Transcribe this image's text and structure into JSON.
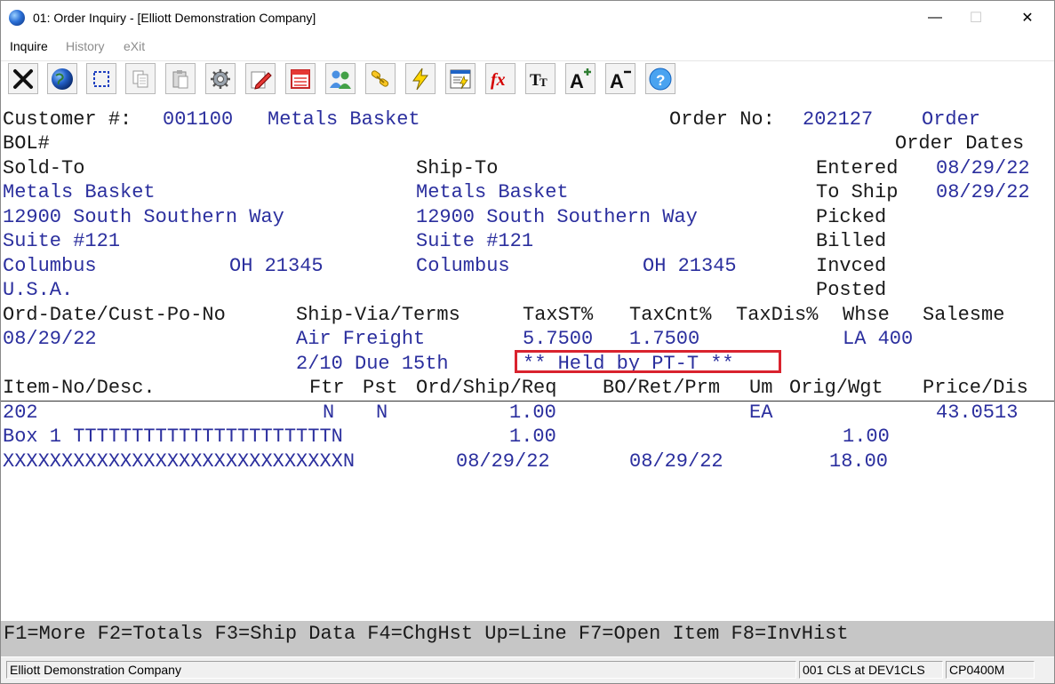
{
  "window": {
    "title": "01: Order Inquiry - [Elliott Demonstration Company]",
    "minimize_glyph": "—",
    "maximize_glyph": "☐",
    "close_glyph": "✕"
  },
  "menu": {
    "inquire": "Inquire",
    "history": "History",
    "exit": "eXit"
  },
  "toolbar_icons": [
    "exit-x-icon",
    "globe-icon",
    "select-rect-icon",
    "copy-icon",
    "paste-icon",
    "settings-gear-icon",
    "edit-pencil-icon",
    "calendar-icon",
    "users-icon",
    "link-icon",
    "lightning-icon",
    "report-icon",
    "function-fx-icon",
    "font-size-icon",
    "increase-font-icon",
    "decrease-font-icon",
    "help-icon"
  ],
  "header": {
    "customer_label": "Customer #:",
    "customer_no": "001100",
    "customer_name": "Metals Basket",
    "order_no_label": "Order No:",
    "order_no": "202127",
    "order_type": "Order",
    "bol_label": "BOL#",
    "order_dates_label": "Order Dates"
  },
  "sold_to": {
    "label": "Sold-To",
    "name": "Metals Basket",
    "addr1": "12900 South Southern Way",
    "addr2": "Suite #121",
    "city": "Columbus",
    "state_zip": "OH 21345",
    "country": "U.S.A."
  },
  "ship_to": {
    "label": "Ship-To",
    "name": "Metals Basket",
    "addr1": "12900 South Southern Way",
    "addr2": "Suite #121",
    "city": "Columbus",
    "state_zip": "OH 21345"
  },
  "dates": {
    "entered_label": "Entered",
    "entered": "08/29/22",
    "to_ship_label": "To Ship",
    "to_ship": "08/29/22",
    "picked_label": "Picked",
    "billed_label": "Billed",
    "invced_label": "Invced",
    "posted_label": "Posted"
  },
  "order_info": {
    "col_date_po": "Ord-Date/Cust-Po-No",
    "col_ship_via": "Ship-Via/Terms",
    "col_taxst": "TaxST%",
    "col_taxcnt": "TaxCnt%",
    "col_taxdis": "TaxDis%",
    "col_whse": "Whse",
    "col_salesman": "Salesme",
    "ord_date": "08/29/22",
    "ship_via": "Air Freight",
    "taxst": "5.7500",
    "taxcnt": "1.7500",
    "whse_sales": "LA 400",
    "terms": "2/10 Due 15th",
    "held": "** Held by PT-T **"
  },
  "lines_header": {
    "item": "Item-No/Desc.",
    "ftr": "Ftr",
    "pst": "Pst",
    "ord_ship_req": "Ord/Ship/Req",
    "bo_ret_prm": "BO/Ret/Prm",
    "um": "Um",
    "orig_wgt": "Orig/Wgt",
    "price_dis": "Price/Dis"
  },
  "line_item": {
    "item_no": "202",
    "ftr": "N",
    "pst": "N",
    "ord_qty": "1.00",
    "um": "EA",
    "price": "43.0513",
    "desc1": "Box 1 TTTTTTTTTTTTTTTTTTTTTTN",
    "ship_qty": "1.00",
    "orig": "1.00",
    "desc2": "XXXXXXXXXXXXXXXXXXXXXXXXXXXXXN",
    "req_date": "08/29/22",
    "prm_date": "08/29/22",
    "weight": "18.00"
  },
  "function_keys": "F1=More F2=Totals F3=Ship Data F4=ChgHst Up=Line F7=Open Item F8=InvHist",
  "status_bar": {
    "company": "Elliott Demonstration Company",
    "session": "001 CLS at DEV1CLS",
    "program": "CP0400M"
  }
}
